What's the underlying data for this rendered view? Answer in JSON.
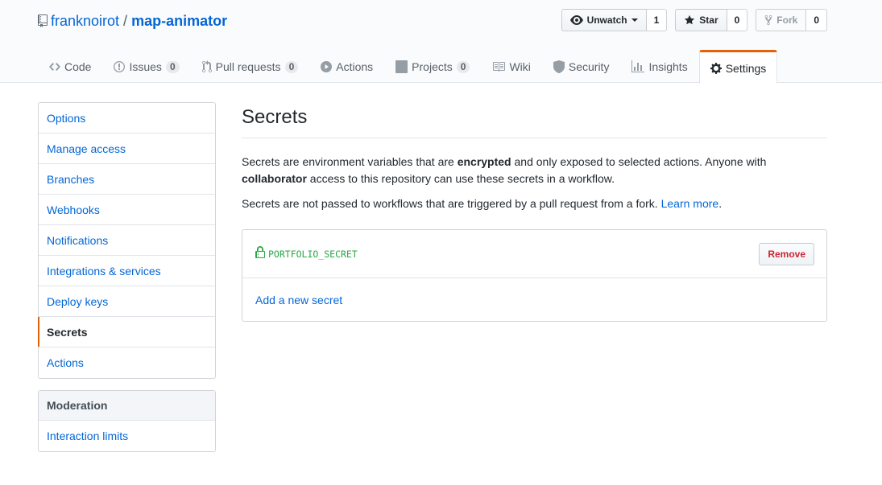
{
  "repo": {
    "owner": "franknoirot",
    "separator": "/",
    "name": "map-animator"
  },
  "actions": {
    "watch_label": "Unwatch",
    "watch_count": "1",
    "star_label": "Star",
    "star_count": "0",
    "fork_label": "Fork",
    "fork_count": "0"
  },
  "nav": {
    "code": "Code",
    "issues": "Issues",
    "issues_count": "0",
    "pulls": "Pull requests",
    "pulls_count": "0",
    "actions": "Actions",
    "projects": "Projects",
    "projects_count": "0",
    "wiki": "Wiki",
    "security": "Security",
    "insights": "Insights",
    "settings": "Settings"
  },
  "sidebar": {
    "items": [
      {
        "label": "Options"
      },
      {
        "label": "Manage access"
      },
      {
        "label": "Branches"
      },
      {
        "label": "Webhooks"
      },
      {
        "label": "Notifications"
      },
      {
        "label": "Integrations & services"
      },
      {
        "label": "Deploy keys"
      },
      {
        "label": "Secrets"
      },
      {
        "label": "Actions"
      }
    ],
    "moderation_heading": "Moderation",
    "moderation_items": [
      {
        "label": "Interaction limits"
      }
    ]
  },
  "main": {
    "title": "Secrets",
    "desc_part1": "Secrets are environment variables that are ",
    "desc_bold1": "encrypted",
    "desc_part2": " and only exposed to selected actions. Anyone with ",
    "desc_bold2": "collaborator",
    "desc_part3": " access to this repository can use these secrets in a workflow.",
    "note": "Secrets are not passed to workflows that are triggered by a pull request from a fork. ",
    "learn_more": "Learn more",
    "note_end": ".",
    "secret_name": "PORTFOLIO_SECRET",
    "remove_label": "Remove",
    "add_secret": "Add a new secret"
  },
  "colors": {
    "link": "#0366d6",
    "accent": "#e36209",
    "secret_green": "#28a745",
    "danger": "#cb2431"
  }
}
